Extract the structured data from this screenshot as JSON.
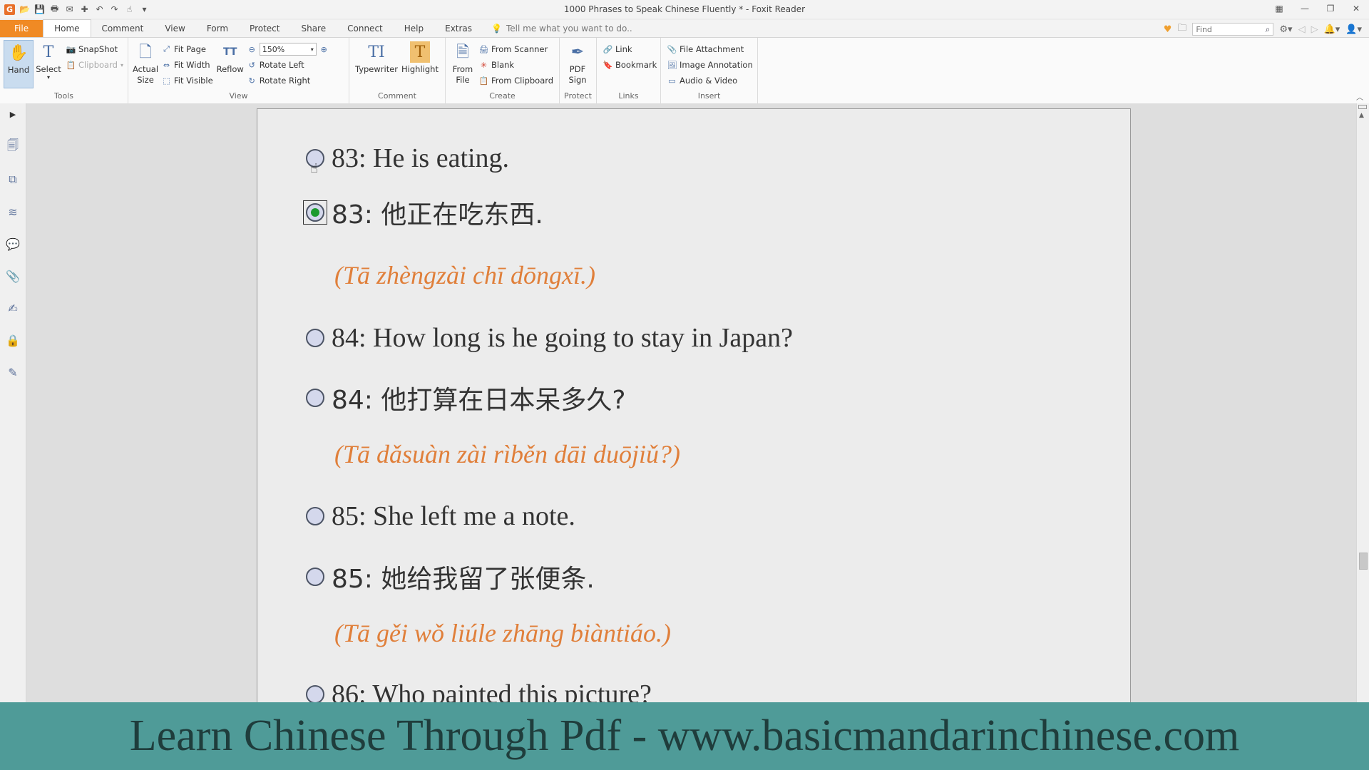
{
  "window": {
    "title": "1000 Phrases to Speak Chinese Fluently * - Foxit Reader",
    "logo": "G"
  },
  "menu": {
    "tabs": [
      "File",
      "Home",
      "Comment",
      "View",
      "Form",
      "Protect",
      "Share",
      "Connect",
      "Help",
      "Extras"
    ],
    "active_tab": "Home",
    "tell_me": "Tell me what you want to do..",
    "find_placeholder": "Find"
  },
  "ribbon": {
    "tools": {
      "label": "Tools",
      "hand": "Hand",
      "select": "Select",
      "snapshot": "SnapShot",
      "clipboard": "Clipboard"
    },
    "view": {
      "label": "View",
      "actual_size": "Actual Size",
      "fit_page": "Fit Page",
      "fit_width": "Fit Width",
      "fit_visible": "Fit Visible",
      "reflow": "Reflow",
      "zoom": "150%",
      "rotate_left": "Rotate Left",
      "rotate_right": "Rotate Right"
    },
    "comment": {
      "label": "Comment",
      "typewriter": "Typewriter",
      "highlight": "Highlight"
    },
    "create": {
      "label": "Create",
      "from_file": "From File",
      "from_scanner": "From Scanner",
      "blank": "Blank",
      "from_clipboard": "From Clipboard"
    },
    "protect": {
      "label": "Protect",
      "pdf_sign": "PDF Sign"
    },
    "links": {
      "label": "Links",
      "link": "Link",
      "bookmark": "Bookmark"
    },
    "insert": {
      "label": "Insert",
      "file_attachment": "File Attachment",
      "image_annotation": "Image Annotation",
      "audio_video": "Audio & Video"
    }
  },
  "document": {
    "phrases": [
      {
        "text": "83: He is eating.",
        "kind": "en",
        "checked": false
      },
      {
        "text": "83: 他正在吃东西.",
        "kind": "zh",
        "checked": true
      },
      {
        "text": "(Tā zhèngzài chī dōngxī.)",
        "kind": "py"
      },
      {
        "text": "84: How long is he going to stay in Japan?",
        "kind": "en",
        "checked": false
      },
      {
        "text": "84: 他打算在日本呆多久?",
        "kind": "zh",
        "checked": false
      },
      {
        "text": "(Tā dǎsuàn zài rìběn dāi duōjiǔ?)",
        "kind": "py"
      },
      {
        "text": "85: She left me a note.",
        "kind": "en",
        "checked": false
      },
      {
        "text": "85: 她给我留了张便条.",
        "kind": "zh",
        "checked": false
      },
      {
        "text": "(Tā gěi wǒ liúle zhāng biàntiáo.)",
        "kind": "py"
      },
      {
        "text": "86: Who painted this picture?",
        "kind": "en",
        "checked": false
      }
    ]
  },
  "banner": {
    "text": "Learn Chinese Through Pdf - www.basicmandarinchinese.com"
  }
}
